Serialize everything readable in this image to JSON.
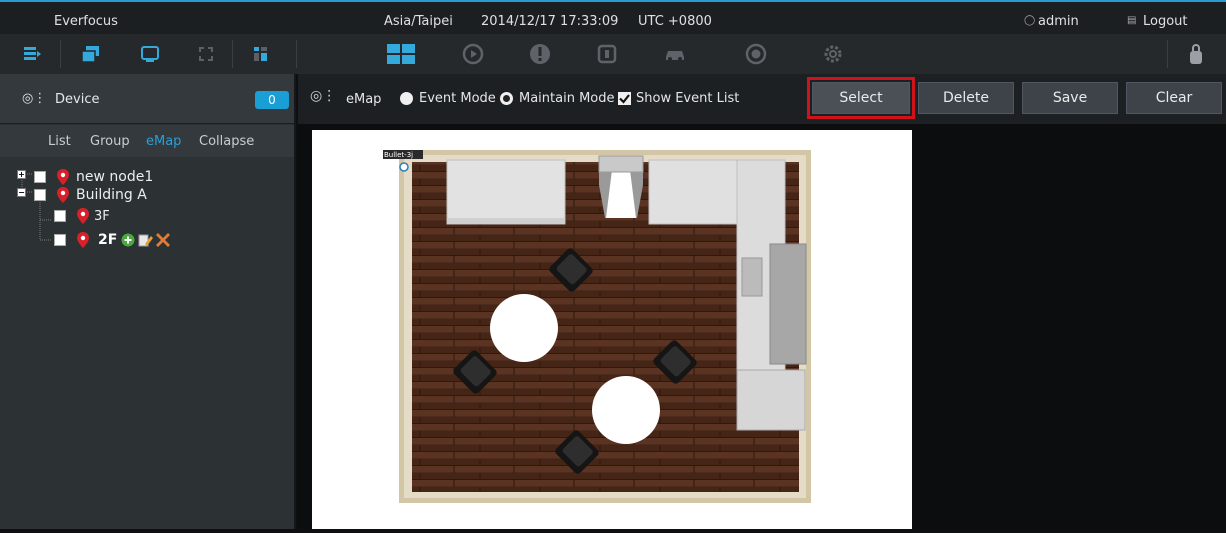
{
  "topbar": {
    "app_name": "Everfocus",
    "timezone": "Asia/Taipei",
    "datetime": "2014/12/17 17:33:09",
    "utc": "UTC +0800",
    "user": "admin",
    "logout": "Logout"
  },
  "icons": [
    "list-view-icon",
    "windows-icon",
    "monitor-icon",
    "fullscreen-icon",
    "layout-grid-icon",
    "camera-grid-icon",
    "playback-icon",
    "alert-icon",
    "io-icon",
    "vehicle-icon",
    "recorder-icon",
    "settings-icon",
    "lock-icon"
  ],
  "sidebar": {
    "title": "Device",
    "count": "0",
    "tabs": [
      "List",
      "Group",
      "eMap",
      "Collapse"
    ],
    "tree": [
      {
        "label": "new node1"
      },
      {
        "label": "Building A"
      },
      {
        "label": "3F"
      },
      {
        "label": "2F"
      }
    ]
  },
  "toolbar": {
    "emap_label": "eMap",
    "event_mode": "Event Mode",
    "maintain_mode": "Maintain Mode",
    "show_event_list": "Show Event List",
    "select": "Select",
    "delete": "Delete",
    "save": "Save",
    "clear": "Clear"
  },
  "map": {
    "camera_label": "Bullet-3j"
  },
  "colors": {
    "accent": "#2a9ad0",
    "highlight_border": "#d0121b",
    "pin": "#d8202a"
  }
}
